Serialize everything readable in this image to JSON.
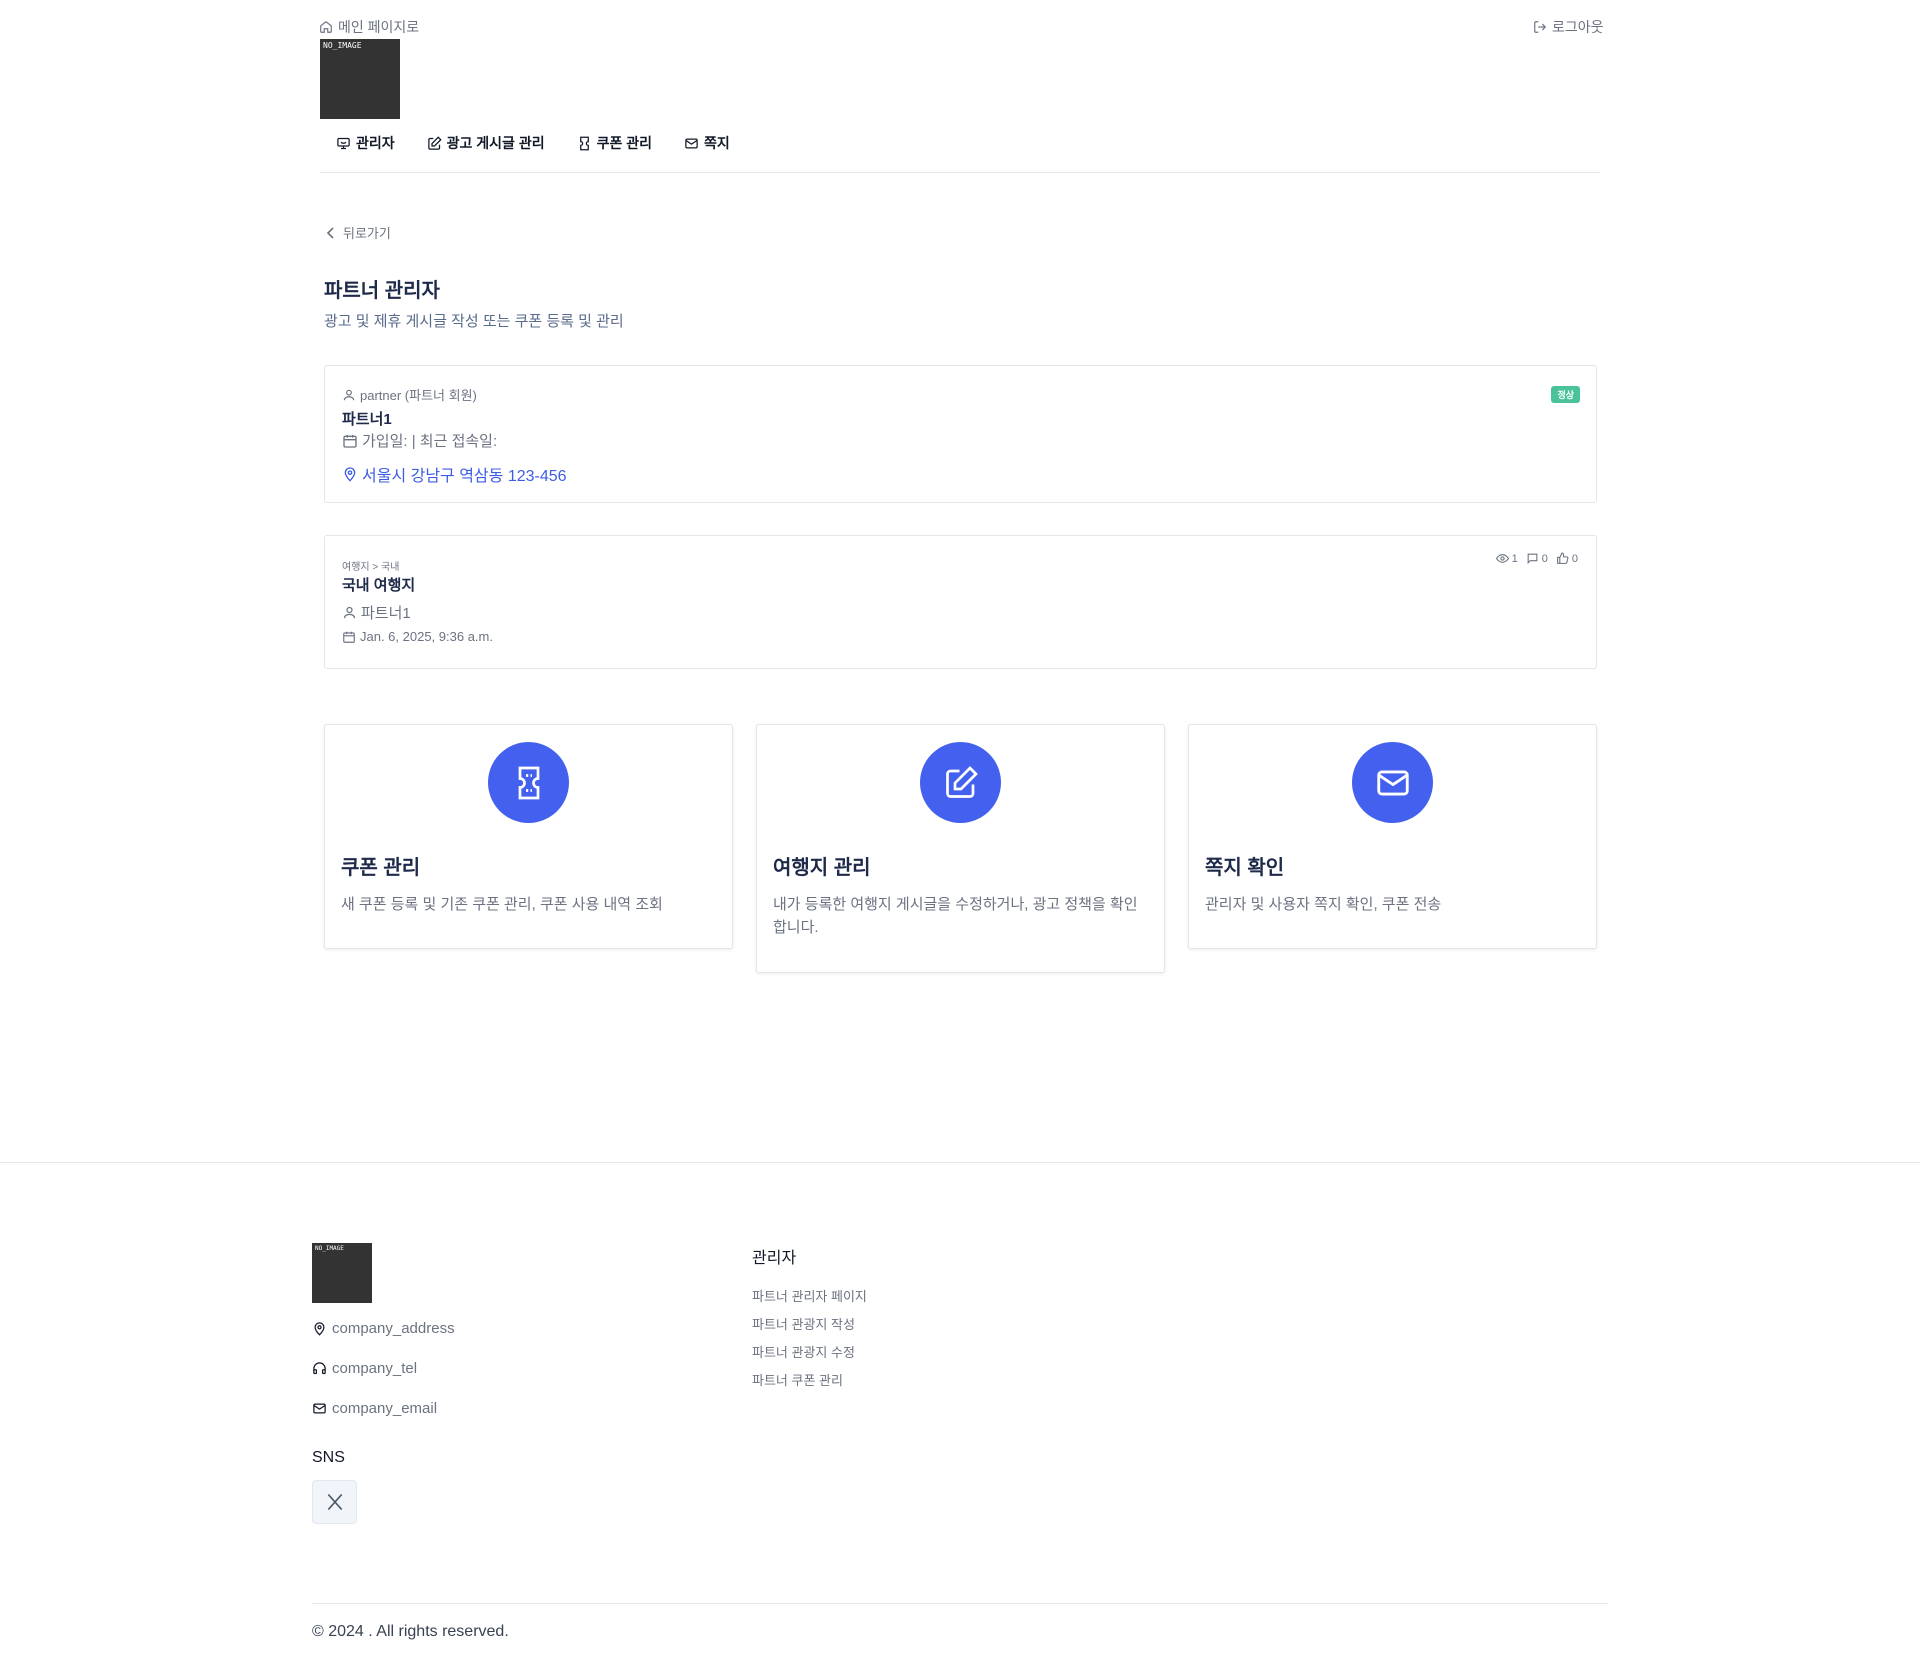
{
  "header": {
    "home_label": "메인 페이지로",
    "logout_label": "로그아웃",
    "logo_text": "NO_IMAGE"
  },
  "nav": [
    {
      "label": "관리자",
      "icon": "monitor-icon"
    },
    {
      "label": "광고 게시글 관리",
      "icon": "edit-icon"
    },
    {
      "label": "쿠폰 관리",
      "icon": "ticket-icon"
    },
    {
      "label": "쪽지",
      "icon": "mail-icon"
    }
  ],
  "back_label": "뒤로가기",
  "page": {
    "title": "파트너 관리자",
    "subtitle": "광고 및 제휴 게시글 작성 또는 쿠폰 등록 및 관리"
  },
  "profile": {
    "role": "partner (파트너 회원)",
    "name": "파트너1",
    "dates": "가입일: | 최근 접속일:",
    "address": "서울시 강남구 역삼동 123-456",
    "status": "정상",
    "status_color": "#4ac29a"
  },
  "post": {
    "category": "여행지 > 국내",
    "title": "국내 여행지",
    "author": "파트너1",
    "date": "Jan. 6, 2025, 9:36 a.m.",
    "views": "1",
    "comments": "0",
    "likes": "0"
  },
  "features": [
    {
      "title": "쿠폰 관리",
      "desc": "새 쿠폰 등록 및 기존 쿠폰 관리, 쿠폰 사용 내역 조회",
      "icon": "ticket-icon"
    },
    {
      "title": "여행지 관리",
      "desc": "내가 등록한 여행지 게시글을 수정하거나, 광고 정책을 확인합니다.",
      "icon": "edit-icon"
    },
    {
      "title": "쪽지 확인",
      "desc": "관리자 및 사용자 쪽지 확인, 쿠폰 전송",
      "icon": "mail-icon"
    }
  ],
  "accent_color": "#4361ee",
  "footer": {
    "logo_text": "NO_IMAGE",
    "address": "company_address",
    "tel": "company_tel",
    "email": "company_email",
    "column_title": "관리자",
    "links": [
      "파트너 관리자 페이지",
      "파트너 관광지 작성",
      "파트너 관광지 수정",
      "파트너 쿠폰 관리"
    ],
    "sns_title": "SNS",
    "sns_icon": "x-logo-icon",
    "copyright": "© 2024 . All rights reserved."
  }
}
